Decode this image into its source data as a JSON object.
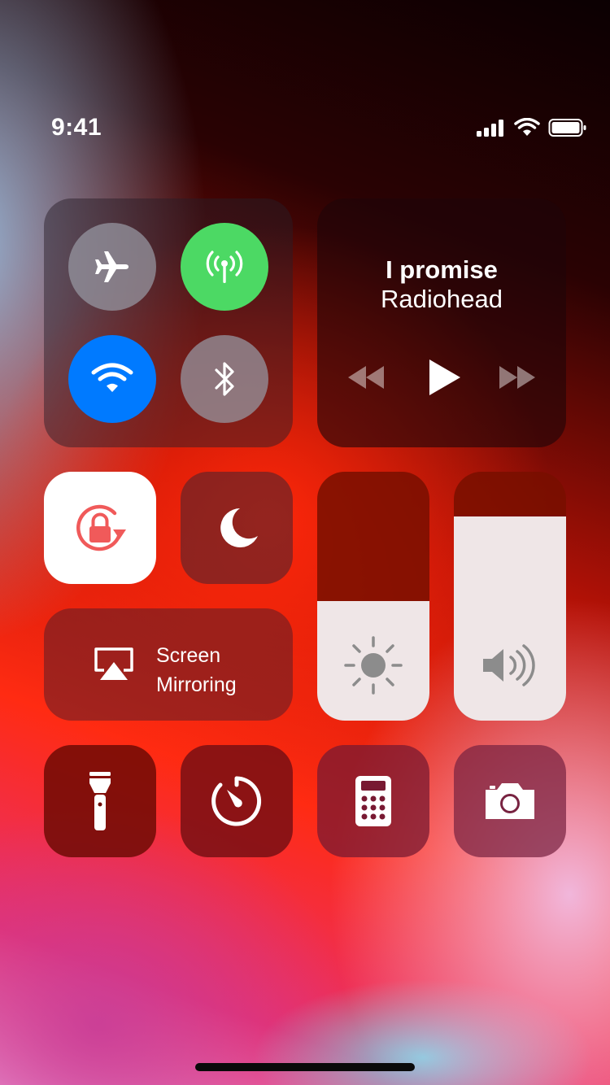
{
  "status_bar": {
    "time": "9:41",
    "signal_icon": "cellular-signal-icon",
    "wifi_icon": "wifi-icon",
    "battery_icon": "battery-icon"
  },
  "connectivity": {
    "airplane": {
      "icon": "airplane-icon",
      "active": false
    },
    "cellular": {
      "icon": "antenna-icon",
      "active": true,
      "color": "#4cd964"
    },
    "wifi": {
      "icon": "wifi-icon",
      "active": true,
      "color": "#007aff"
    },
    "bluetooth": {
      "icon": "bluetooth-icon",
      "active": false
    }
  },
  "now_playing": {
    "title": "I promise",
    "artist": "Radiohead",
    "controls": [
      "rewind-icon",
      "play-icon",
      "fast-forward-icon"
    ]
  },
  "toggles": {
    "orientation_lock": {
      "icon": "rotation-lock-icon",
      "active": true,
      "color": "#f05a5a"
    },
    "do_not_disturb": {
      "icon": "moon-icon",
      "active": false
    }
  },
  "screen_mirroring": {
    "line1": "Screen",
    "line2": "Mirroring",
    "icon": "airplay-icon"
  },
  "sliders": {
    "brightness": {
      "icon": "sun-icon",
      "level": 0.48
    },
    "volume": {
      "icon": "speaker-icon",
      "level": 0.82
    }
  },
  "shortcuts": [
    "flashlight-icon",
    "timer-icon",
    "calculator-icon",
    "camera-icon"
  ]
}
